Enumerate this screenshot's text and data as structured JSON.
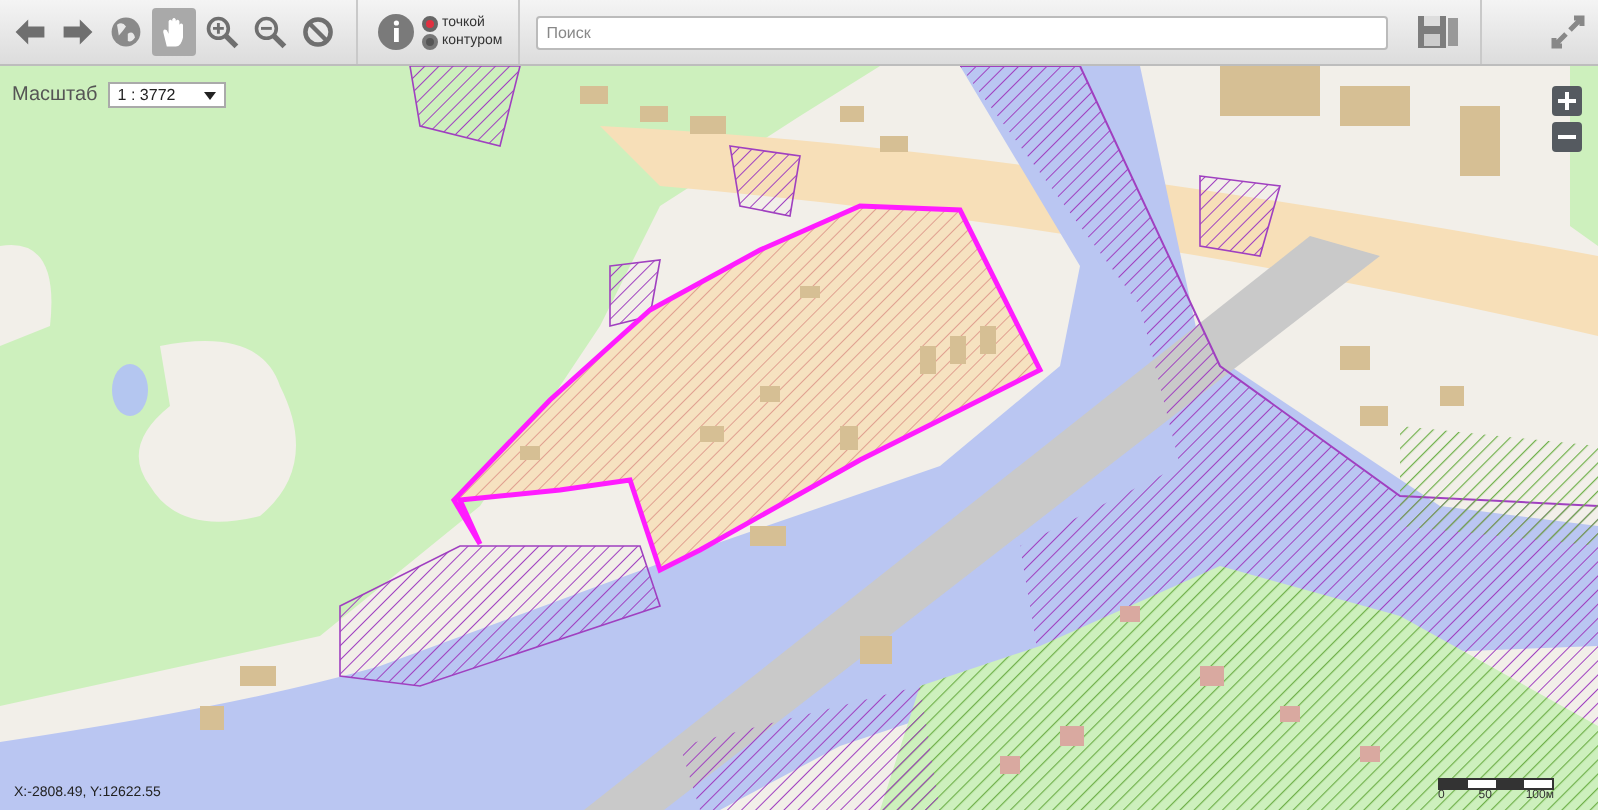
{
  "toolbar": {
    "tools": [
      {
        "kind": "back",
        "selected": false
      },
      {
        "kind": "forward",
        "selected": false
      },
      {
        "kind": "globe",
        "selected": false
      },
      {
        "kind": "hand",
        "selected": true
      },
      {
        "kind": "zoom-in",
        "selected": false
      },
      {
        "kind": "zoom-out",
        "selected": false
      },
      {
        "kind": "clear",
        "selected": false
      }
    ],
    "select_mode": [
      {
        "label": "точкой",
        "selected": true
      },
      {
        "label": "контуром",
        "selected": false
      }
    ],
    "search": {
      "placeholder": "Поиск"
    }
  },
  "map": {
    "scale_label": "Масштаб",
    "scale_value": "1 : 3772",
    "coordinates": "X:-2808.49, Y:12622.55",
    "scale_bar": [
      "0",
      "50",
      "100м"
    ]
  }
}
